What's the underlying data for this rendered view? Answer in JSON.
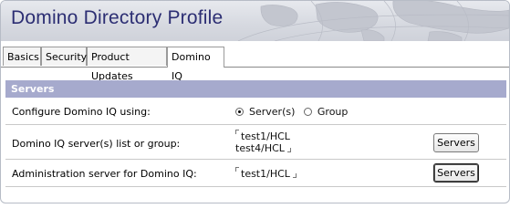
{
  "header": {
    "title": "Domino Directory Profile"
  },
  "tabs": [
    {
      "label": "Basics",
      "active": false
    },
    {
      "label": "Security",
      "active": false
    },
    {
      "label": "Product Updates",
      "active": false
    },
    {
      "label": "Domino IQ",
      "active": true
    }
  ],
  "section": {
    "title": "Servers"
  },
  "rows": {
    "configure": {
      "label": "Configure Domino IQ using:",
      "options": [
        {
          "label": "Server(s)",
          "selected": true
        },
        {
          "label": "Group",
          "selected": false
        }
      ]
    },
    "server_list": {
      "label": "Domino IQ server(s) list or group:",
      "values": [
        "test1/HCL",
        "test4/HCL"
      ],
      "button_label": "Servers"
    },
    "admin_server": {
      "label": "Administration server for Domino IQ:",
      "value": "test1/HCL",
      "button_label": "Servers"
    }
  },
  "colors": {
    "title": "#2c2e73",
    "section_bar": "#a6aacd",
    "header_bg": "#d6d9e0"
  }
}
